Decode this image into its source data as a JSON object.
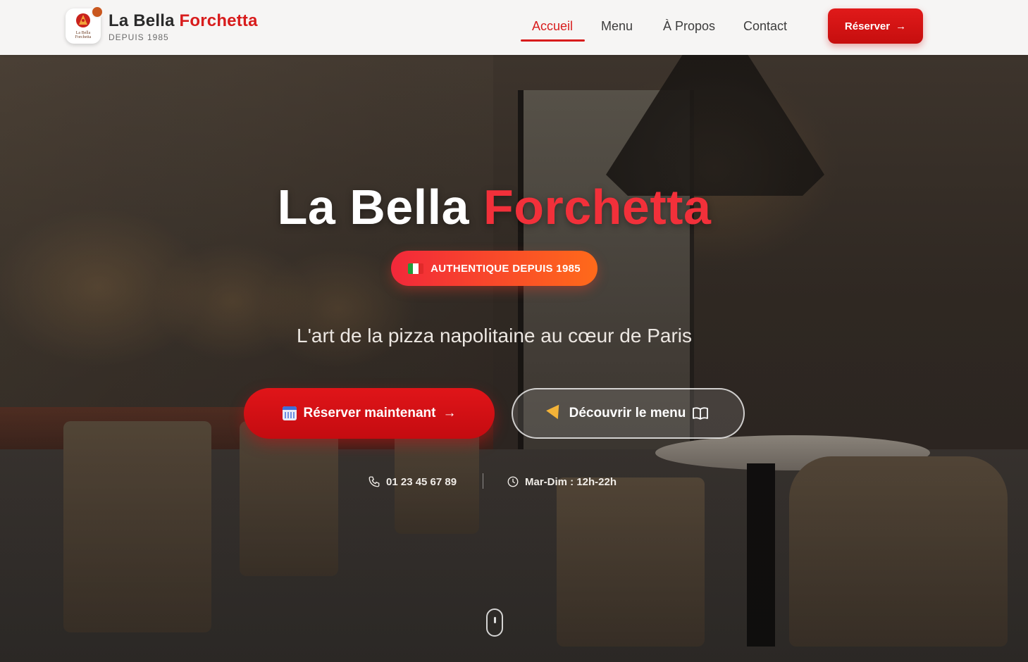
{
  "header": {
    "brand_part1": "La Bella",
    "brand_part2": "Forchetta",
    "brand_sub": "DEPUIS 1985",
    "logo_script_line1": "La Bella",
    "logo_script_line2": "Forchetta",
    "nav": [
      {
        "label": "Accueil",
        "active": true
      },
      {
        "label": "Menu",
        "active": false
      },
      {
        "label": "À Propos",
        "active": false
      },
      {
        "label": "Contact",
        "active": false
      }
    ],
    "reserve_label": "Réserver",
    "reserve_arrow": "→"
  },
  "hero": {
    "title_part1": "La Bella",
    "title_part2": "Forchetta",
    "pill_label": "AUTHENTIQUE DEPUIS 1985",
    "tagline": "L'art de la pizza napolitaine au cœur de Paris",
    "primary_cta": "Réserver maintenant",
    "primary_cta_arrow": "→",
    "secondary_cta": "Découvrir le menu",
    "phone": "01 23 45 67 89",
    "hours": "Mar-Dim : 12h-22h"
  },
  "colors": {
    "accent": "#d81c1c",
    "hero_accent": "#f2303a",
    "pill_start": "#f2283a",
    "pill_end": "#ff6a1a"
  },
  "icons": {
    "flag": "italy-flag-icon",
    "calendar": "calendar-icon",
    "pizza": "pizza-icon",
    "book": "book-icon",
    "phone": "phone-icon",
    "clock": "clock-icon",
    "scroll": "scroll-mouse-icon"
  }
}
